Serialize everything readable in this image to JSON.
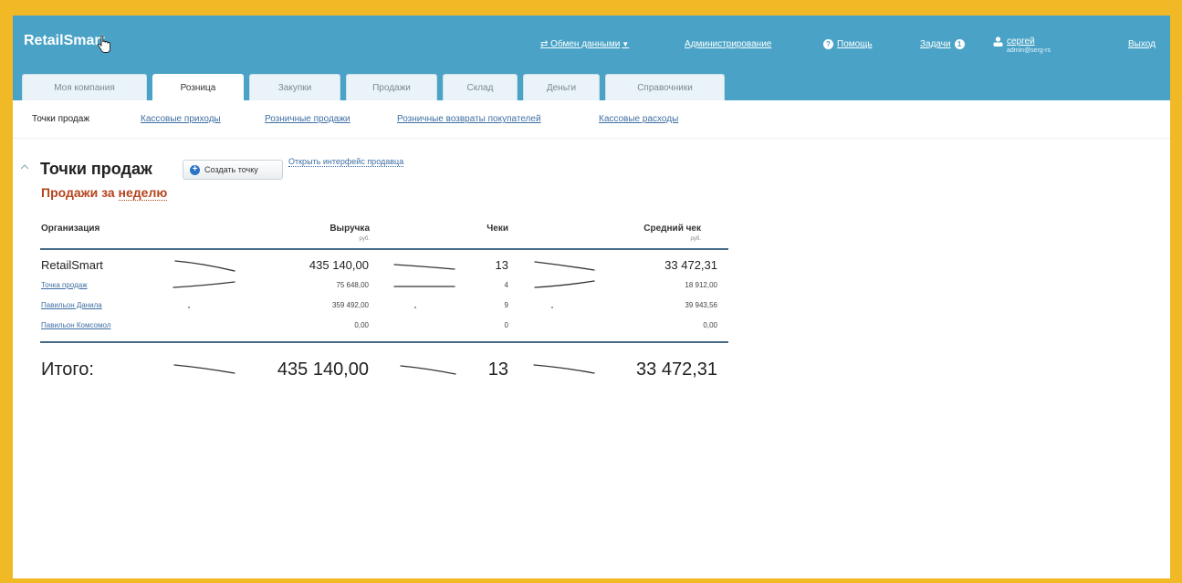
{
  "app": {
    "brand": "RetailSmart",
    "accent_color": "#4aa3c7",
    "frame_color": "#f2b927",
    "warning_color": "#b5431c"
  },
  "topbar": {
    "exchange": "Обмен данными",
    "admin": "Администрирование",
    "help": "Помощь",
    "tasks": "Задачи",
    "tasks_count": "1",
    "user_name": "сергей",
    "user_email": "admin@serg-rs",
    "logout": "Выход"
  },
  "tabs": [
    "Моя компания",
    "Розница",
    "Закупки",
    "Продажи",
    "Склад",
    "Деньги",
    "Справочники"
  ],
  "active_tab": "Розница",
  "subnav": [
    "Точки продаж",
    "Кассовые приходы",
    "Розничные продажи",
    "Розничные возвраты покупателей",
    "Кассовые расходы"
  ],
  "page": {
    "title": "Точки продаж",
    "create_button": "Создать точку",
    "open_interface_link": "Открыть интерфейс продавца",
    "period_prefix": "Продажи за ",
    "period_value": "неделю"
  },
  "table": {
    "headers": {
      "org": "Организация",
      "revenue": "Выручка",
      "revenue_unit": "руб.",
      "checks": "Чеки",
      "avg": "Средний чек",
      "avg_unit": "руб."
    },
    "main_row": {
      "name": "RetailSmart",
      "revenue": "435 140,00",
      "checks": "13",
      "avg": "33 472,31"
    },
    "rows": [
      {
        "name": "Точка продаж",
        "revenue": "75 648,00",
        "checks": "4",
        "avg": "18 912,00"
      },
      {
        "name": "Павильон Данила",
        "revenue": "359 492,00",
        "checks": "9",
        "avg": "39 943,56"
      },
      {
        "name": "Павильон Комсомол",
        "revenue": "0,00",
        "checks": "0",
        "avg": "0,00"
      }
    ],
    "total": {
      "label": "Итого:",
      "revenue": "435 140,00",
      "checks": "13",
      "avg": "33 472,31"
    }
  }
}
